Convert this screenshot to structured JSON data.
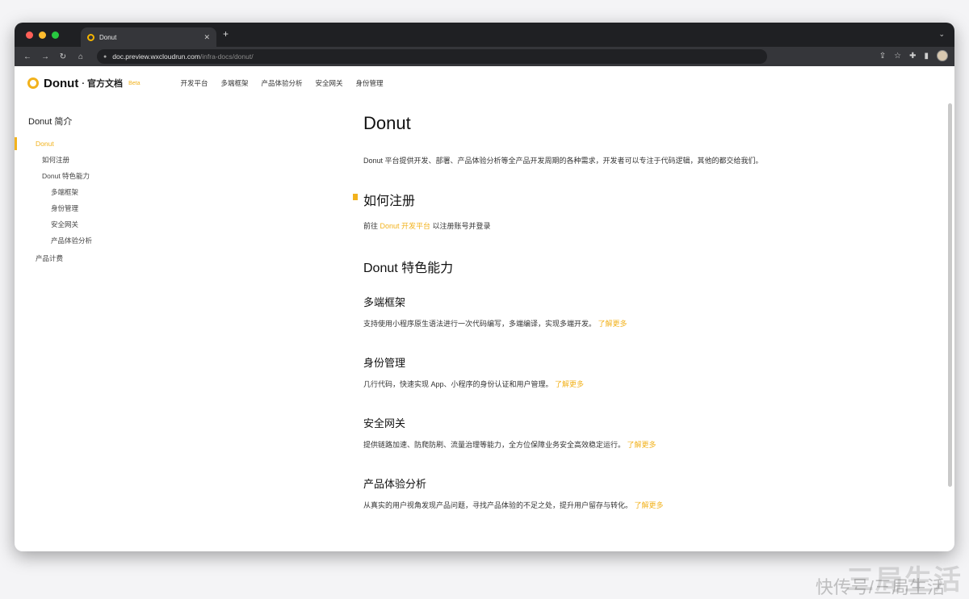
{
  "browser": {
    "tab_title": "Donut",
    "url_host": "doc.preview.wxcloudrun.com",
    "url_path": "/infra-docs/donut/"
  },
  "header": {
    "brand": "Donut",
    "brand_sub": "· 官方文档",
    "badge": "Beta",
    "nav": [
      "开发平台",
      "多端框架",
      "产品体验分析",
      "安全网关",
      "身份管理"
    ]
  },
  "sidebar": {
    "heading": "Donut 简介",
    "items": [
      {
        "label": "Donut",
        "level": 1,
        "active": true
      },
      {
        "label": "如何注册",
        "level": 2,
        "active": false
      },
      {
        "label": "Donut 特色能力",
        "level": 2,
        "active": false
      },
      {
        "label": "多端框架",
        "level": 3,
        "active": false
      },
      {
        "label": "身份管理",
        "level": 3,
        "active": false
      },
      {
        "label": "安全网关",
        "level": 3,
        "active": false
      },
      {
        "label": "产品体验分析",
        "level": 3,
        "active": false
      },
      {
        "label": "产品计费",
        "level": 1,
        "active": false
      }
    ]
  },
  "content": {
    "title": "Donut",
    "intro": "Donut 平台提供开发、部署、产品体验分析等全产品开发周期的各种需求，开发者可以专注于代码逻辑，其他的都交给我们。",
    "register_heading": "如何注册",
    "register_prefix": "前往 ",
    "register_link": "Donut 开发平台",
    "register_suffix": " 以注册账号并登录",
    "features_heading": "Donut 特色能力",
    "features": [
      {
        "title": "多端框架",
        "text": "支持使用小程序原生语法进行一次代码编写，多端编译，实现多端开发。",
        "link": "了解更多"
      },
      {
        "title": "身份管理",
        "text": "几行代码，快速实现 App、小程序的身份认证和用户管理。",
        "link": "了解更多"
      },
      {
        "title": "安全网关",
        "text": "提供链路加速、防爬防刷、流量治理等能力，全方位保障业务安全高效稳定运行。",
        "link": "了解更多"
      },
      {
        "title": "产品体验分析",
        "text": "从真实的用户视角发现产品问题，寻找产品体验的不足之处，提升用户留存与转化。",
        "link": "了解更多"
      }
    ]
  },
  "watermark": {
    "line1": "三局生活",
    "line2": "快传号/三局生活"
  },
  "colors": {
    "accent": "#f2b21c",
    "chrome_dark": "#1f2023",
    "toolbar": "#35363a"
  }
}
